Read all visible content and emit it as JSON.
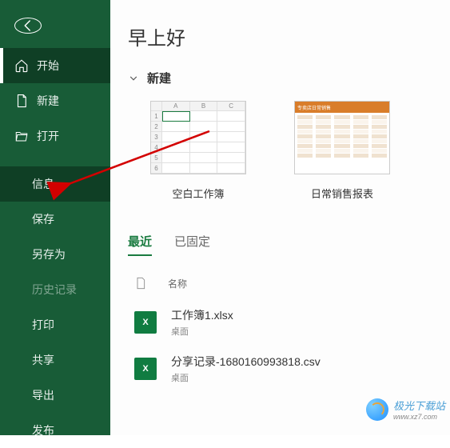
{
  "sidebar": {
    "items": [
      {
        "label": "开始"
      },
      {
        "label": "新建"
      },
      {
        "label": "打开"
      }
    ],
    "subitems": [
      {
        "label": "信息"
      },
      {
        "label": "保存"
      },
      {
        "label": "另存为"
      },
      {
        "label": "历史记录"
      },
      {
        "label": "打印"
      },
      {
        "label": "共享"
      },
      {
        "label": "导出"
      },
      {
        "label": "发布"
      }
    ]
  },
  "main": {
    "greeting": "早上好",
    "section_new": "新建",
    "templates": [
      {
        "name": "空白工作簿",
        "cols": [
          "A",
          "B",
          "C"
        ],
        "rows": [
          "1",
          "2",
          "3",
          "4",
          "5",
          "6"
        ]
      },
      {
        "name": "日常销售报表",
        "header": "专卖店日常销售"
      }
    ],
    "tabs": [
      {
        "label": "最近",
        "active": true
      },
      {
        "label": "已固定",
        "active": false
      }
    ],
    "file_header": {
      "name_col": "名称"
    },
    "files": [
      {
        "name": "工作簿1.xlsx",
        "location": "桌面",
        "icon": "X"
      },
      {
        "name": "分享记录-1680160993818.csv",
        "location": "桌面",
        "icon": "X"
      }
    ]
  },
  "watermark": {
    "line1": "极光下载站",
    "line2": "www.xz7.com"
  }
}
